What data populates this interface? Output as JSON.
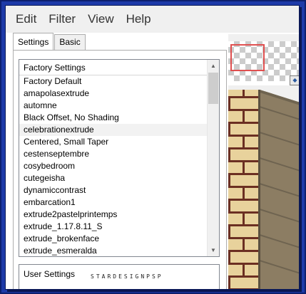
{
  "menu": [
    "Edit",
    "Filter",
    "View",
    "Help"
  ],
  "tabs": [
    {
      "label": "Settings",
      "active": true
    },
    {
      "label": "Basic",
      "active": false
    }
  ],
  "factory_settings": {
    "header": "Factory Settings",
    "items": [
      "Factory Default",
      "amapolasextrude",
      "automne",
      "Black Offset, No Shading",
      "celebrationextrude",
      "Centered, Small Taper",
      "cestenseptembre",
      "cosybedroom",
      "cutegeisha",
      "dynamiccontrast",
      "embarcation1",
      "extrude2pastelprintemps",
      "extrude_1.17.8.11_S",
      "extrude_brokenface",
      "extrude_esmeralda"
    ],
    "selected_index": 4
  },
  "user_settings": {
    "header": "User Settings",
    "watermark": "STARDESIGNPSP"
  },
  "colors": {
    "frame": "#1d3aa8",
    "brick": "#e8d29c",
    "mortar": "#6b2f22",
    "wall_side": "#8c7d63",
    "wall_edge": "#5a5040"
  }
}
